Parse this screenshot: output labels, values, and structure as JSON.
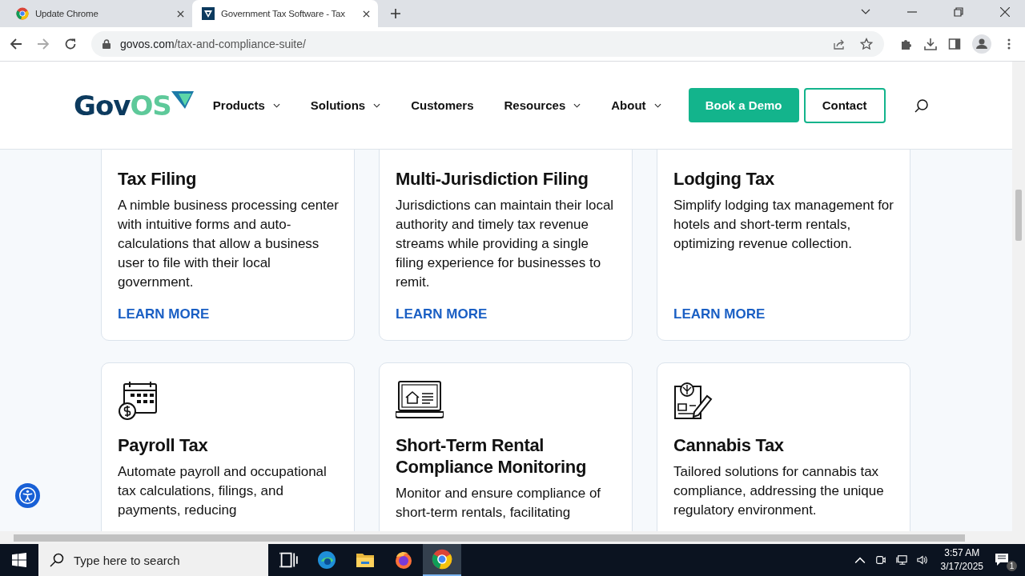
{
  "browser": {
    "tabs": [
      {
        "title": "Update Chrome",
        "selected": false
      },
      {
        "title": "Government Tax Software - Tax",
        "selected": true
      }
    ],
    "url_host": "govos.com",
    "url_path": "/tax-and-compliance-suite/"
  },
  "site": {
    "logo_main": "Gov",
    "logo_accent": "OS",
    "nav": [
      {
        "label": "Products",
        "dropdown": true
      },
      {
        "label": "Solutions",
        "dropdown": true
      },
      {
        "label": "Customers",
        "dropdown": false
      },
      {
        "label": "Resources",
        "dropdown": true
      },
      {
        "label": "About",
        "dropdown": true
      }
    ],
    "primary_button": "Book a Demo",
    "secondary_button": "Contact"
  },
  "cards": [
    {
      "title": "Tax Filing",
      "body": "A nimble business processing center with intuitive forms and auto-calculations that allow a business user to file with their local government.",
      "link": "LEARN MORE"
    },
    {
      "title": "Multi-Jurisdiction Filing",
      "body": "Jurisdictions can maintain their local authority and timely tax revenue streams while providing a single filing experience for businesses to remit.",
      "link": "LEARN MORE"
    },
    {
      "title": "Lodging Tax",
      "body": "Simplify lodging tax management for hotels and short-term rentals, optimizing revenue collection.",
      "link": "LEARN MORE"
    },
    {
      "title": "Payroll Tax",
      "body": "Automate payroll and occupational tax calculations, filings, and payments, reducing"
    },
    {
      "title": "Short-Term Rental Compliance Monitoring",
      "body": "Monitor and ensure compliance of short-term rentals, facilitating"
    },
    {
      "title": "Cannabis Tax",
      "body": "Tailored solutions for cannabis tax compliance, addressing the unique regulatory environment."
    }
  ],
  "taskbar": {
    "search_placeholder": "Type here to search",
    "time": "3:57 AM",
    "date": "3/17/2025",
    "notifications": "1"
  }
}
